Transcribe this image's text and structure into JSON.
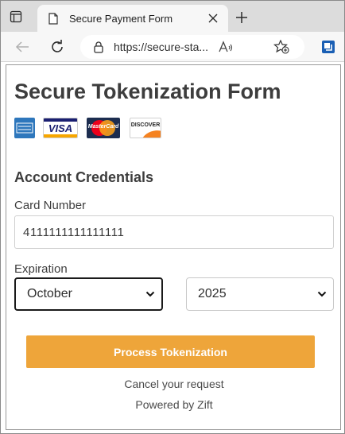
{
  "browser": {
    "tab_title": "Secure Payment Form",
    "url": "https://secure-sta...",
    "read_aloud_label": "Aᵃ"
  },
  "form": {
    "title": "Secure Tokenization Form",
    "cards": [
      {
        "name": "amex-logo",
        "label": "AMERICAN EXPRESS"
      },
      {
        "name": "visa-logo",
        "label": "VISA"
      },
      {
        "name": "mastercard-logo",
        "label": "MasterCard"
      },
      {
        "name": "discover-logo",
        "label": "DISCOVER"
      }
    ],
    "section_title": "Account Credentials",
    "card_number_label": "Card Number",
    "card_number_value": "4111111111111111",
    "expiration_label": "Expiration",
    "month_value": "October",
    "year_value": "2025",
    "submit_label": "Process Tokenization",
    "cancel_text": "Cancel your request",
    "powered_text": "Powered by Zift"
  },
  "colors": {
    "accent": "#eea53a",
    "amex": "#2e77bc",
    "visa_blue": "#1a1f71",
    "visa_gold": "#f7a600",
    "mastercard_red": "#eb001b",
    "mastercard_orange": "#f79e1b",
    "discover_orange": "#f58220"
  }
}
